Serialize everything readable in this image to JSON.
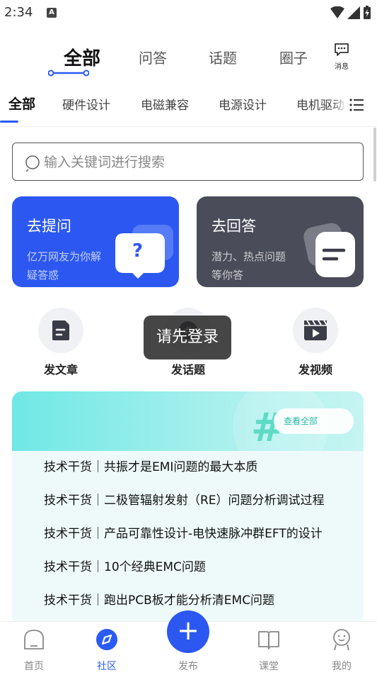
{
  "status_bar": {
    "time": "2:34",
    "notification_glyph": "A"
  },
  "top_tabs": [
    {
      "label": "全部",
      "active": true
    },
    {
      "label": "问答",
      "active": false
    },
    {
      "label": "话题",
      "active": false
    },
    {
      "label": "圈子",
      "active": false
    }
  ],
  "messages_label": "消息",
  "categories": [
    "全部",
    "硬件设计",
    "电磁兼容",
    "电源设计",
    "电机驱动"
  ],
  "search": {
    "placeholder": "输入关键词进行搜索"
  },
  "ask_card": {
    "title": "去提问",
    "subtitle": "亿万网友为你解疑答惑",
    "icon_glyph": "?"
  },
  "answer_card": {
    "title": "去回答",
    "subtitle": "潜力、热点问题等你答"
  },
  "quick_actions": [
    {
      "label": "发文章",
      "icon": "article-icon"
    },
    {
      "label": "发话题",
      "icon": "topic-icon"
    },
    {
      "label": "发视频",
      "icon": "video-icon"
    }
  ],
  "toast": "请先登录",
  "topics": {
    "view_all": "查看全部",
    "items": [
      "技术干货｜共振才是EMI问题的最大本质",
      "技术干货｜二极管辐射发射（RE）问题分析调试过程",
      "技术干货｜产品可靠性设计-电快速脉冲群EFT的设计",
      "技术干货｜10个经典EMC问题",
      "技术干货｜跑出PCB板才能分析清EMC问题"
    ]
  },
  "bottom_nav": [
    {
      "label": "首页",
      "icon": "home-icon",
      "active": false
    },
    {
      "label": "社区",
      "icon": "community-icon",
      "active": true
    },
    {
      "label": "发布",
      "icon": "plus-icon",
      "active": false
    },
    {
      "label": "课堂",
      "icon": "book-icon",
      "active": false
    },
    {
      "label": "我的",
      "icon": "profile-icon",
      "active": false
    }
  ],
  "colors": {
    "accent": "#2c58f1",
    "dark_card": "#4a4c5a",
    "teal": "#6fe8e5"
  }
}
